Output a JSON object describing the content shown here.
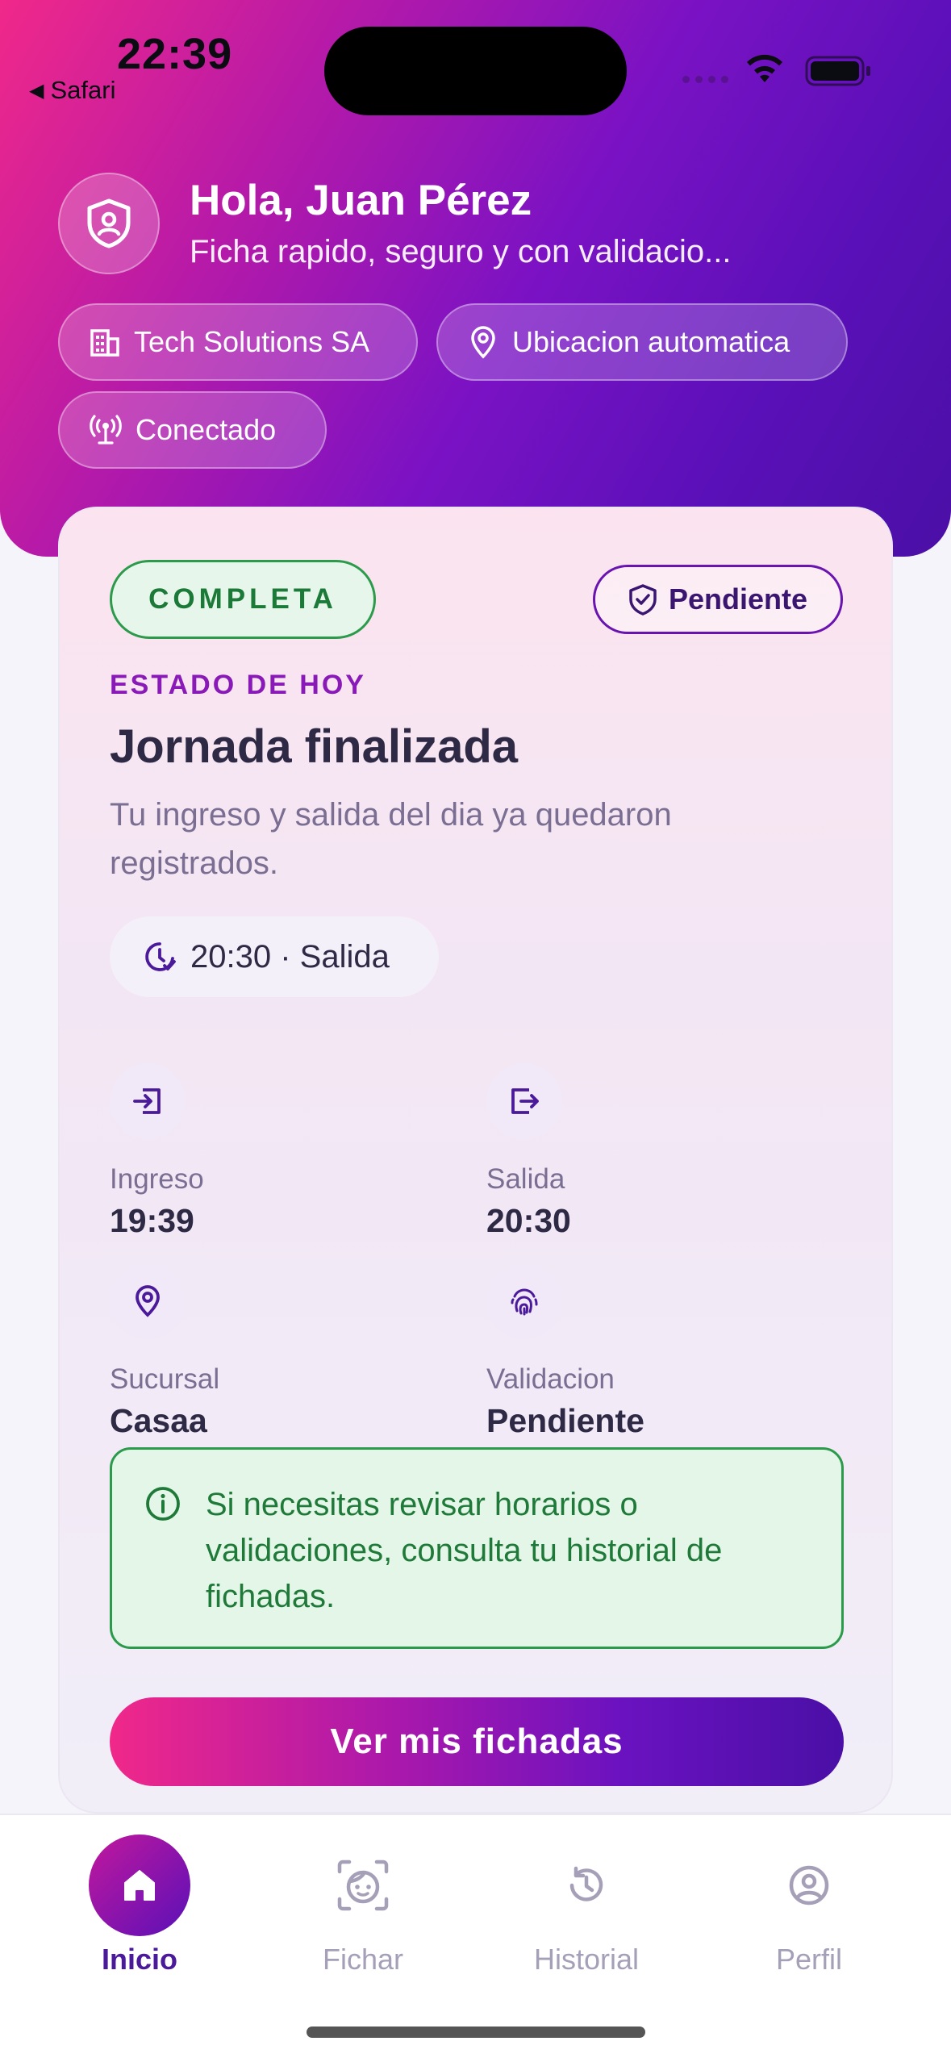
{
  "status_bar": {
    "time": "22:39",
    "back_app": "Safari"
  },
  "header": {
    "greeting": "Hola, Juan Pérez",
    "subtitle": "Ficha rapido, seguro y con validacio...",
    "chips": {
      "company": "Tech Solutions SA",
      "location": "Ubicacion automatica",
      "connection": "Conectado"
    }
  },
  "card": {
    "status_badge": "COMPLETA",
    "validation_badge": "Pendiente",
    "eyebrow": "ESTADO DE HOY",
    "title": "Jornada finalizada",
    "description": "Tu ingreso y salida del dia ya quedaron registrados.",
    "last_event": "20:30 · Salida",
    "stats": {
      "check_in": {
        "label": "Ingreso",
        "value": "19:39"
      },
      "check_out": {
        "label": "Salida",
        "value": "20:30"
      },
      "branch": {
        "label": "Sucursal",
        "value": "Casaa"
      },
      "validation": {
        "label": "Validacion",
        "value": "Pendiente"
      }
    },
    "info": "Si necesitas revisar horarios o validaciones, consulta tu historial de fichadas.",
    "cta": "Ver mis fichadas"
  },
  "tabbar": {
    "items": [
      {
        "label": "Inicio",
        "icon": "home-icon",
        "active": true
      },
      {
        "label": "Fichar",
        "icon": "face-scan-icon",
        "active": false
      },
      {
        "label": "Historial",
        "icon": "history-icon",
        "active": false
      },
      {
        "label": "Perfil",
        "icon": "profile-icon",
        "active": false
      }
    ]
  },
  "colors": {
    "brand_pink": "#f0288a",
    "brand_purple": "#5a10b8",
    "success_green": "#2b9a4b",
    "accent_violet": "#8a1ab8"
  }
}
